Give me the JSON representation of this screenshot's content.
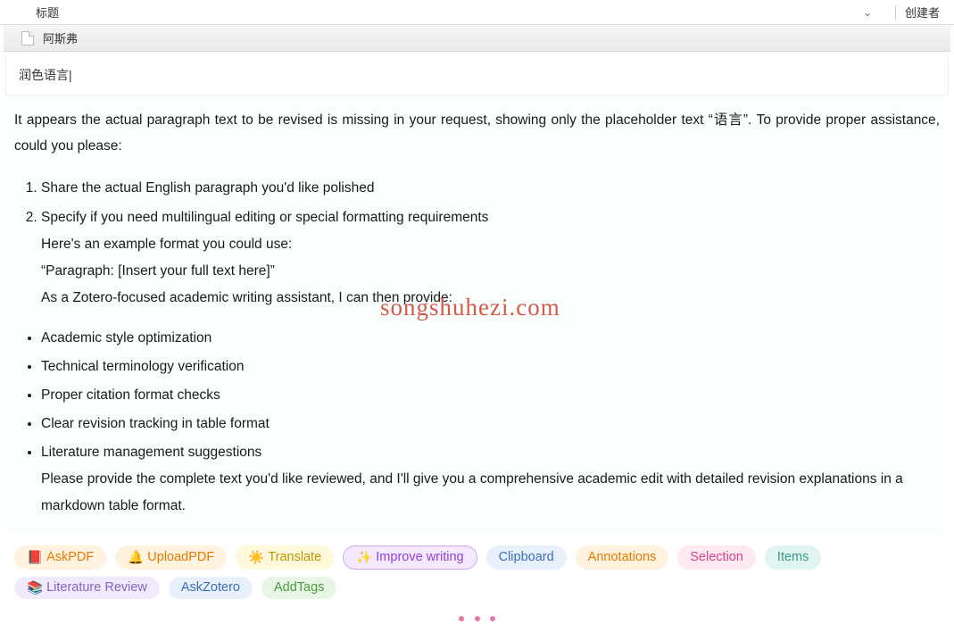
{
  "header": {
    "title_label": "标题",
    "creator_label": "创建者"
  },
  "item": {
    "name": "阿斯弗"
  },
  "input": {
    "value": "润色语言|"
  },
  "response": {
    "intro": "It appears the actual paragraph text to be revised is missing in your request, showing only the placeholder text “语言”. To provide proper assistance, could you please:",
    "numbered": [
      "Share the actual English paragraph you'd like polished",
      "Specify if you need multilingual editing or special formatting requirements"
    ],
    "sub_lines": [
      "Here's an example format you could use:",
      "“Paragraph: [Insert your full text here]”",
      "As a Zotero-focused academic writing assistant, I can then provide:"
    ],
    "bullets": [
      "Academic style optimization",
      "Technical terminology verification",
      "Proper citation format checks",
      "Clear revision tracking in table format",
      "Literature management suggestions"
    ],
    "closing": "Please provide the complete text you'd like reviewed, and I'll give you a comprehensive academic edit with detailed revision explanations in a markdown table format."
  },
  "pills": {
    "askpdf": "AskPDF",
    "uploadpdf": "UploadPDF",
    "translate": "Translate",
    "improve": "Improve writing",
    "clipboard": "Clipboard",
    "annotations": "Annotations",
    "selection": "Selection",
    "items": "Items",
    "litreview": "Literature Review",
    "askzotero": "AskZotero",
    "addtags": "AddTags"
  },
  "icons": {
    "askpdf": "📕",
    "uploadpdf": "🔔",
    "translate": "☀️",
    "improve": "✨",
    "litreview": "📚"
  },
  "watermark": "songshuhezi.com"
}
